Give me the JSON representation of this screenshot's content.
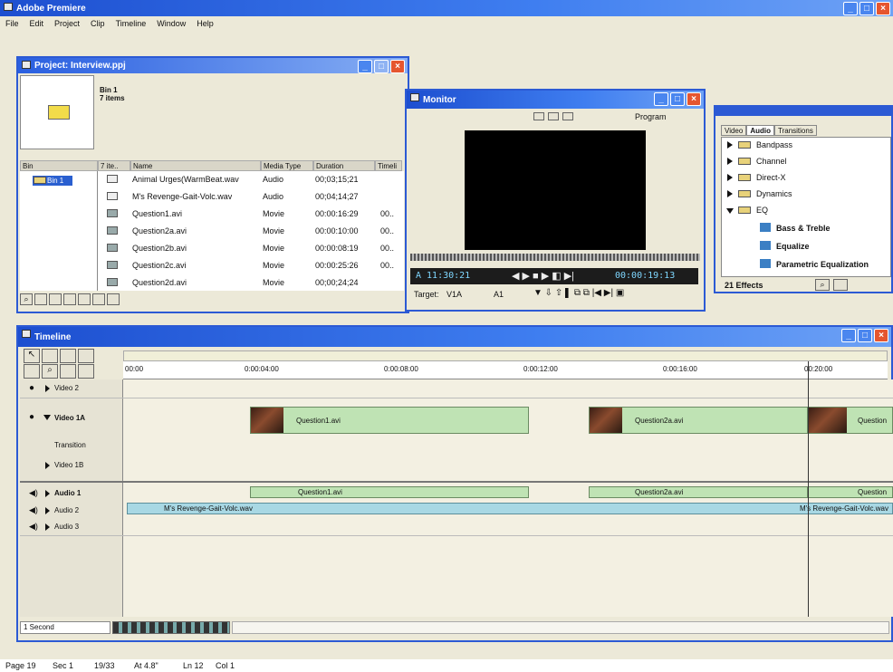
{
  "app": {
    "title": "Adobe Premiere"
  },
  "menu": [
    "File",
    "Edit",
    "Project",
    "Clip",
    "Timeline",
    "Window",
    "Help"
  ],
  "project": {
    "title": "Project: Interview.ppj",
    "bin_name": "Bin 1",
    "bin_count": "7 items",
    "columns": [
      "Bin",
      "7 ite..",
      "Name",
      "Media Type",
      "Duration",
      "Timeli"
    ],
    "sidebar_bin": "Bin 1",
    "items": [
      {
        "name": "Animal Urges(WarmBeat.wav",
        "type": "Audio",
        "duration": "00;03;15;21",
        "extra": ""
      },
      {
        "name": "M's Revenge-Gait-Volc.wav",
        "type": "Audio",
        "duration": "00;04;14;27",
        "extra": ""
      },
      {
        "name": "Question1.avi",
        "type": "Movie",
        "duration": "00:00:16:29",
        "extra": "00.."
      },
      {
        "name": "Question2a.avi",
        "type": "Movie",
        "duration": "00:00:10:00",
        "extra": "00.."
      },
      {
        "name": "Question2b.avi",
        "type": "Movie",
        "duration": "00:00:08:19",
        "extra": "00.."
      },
      {
        "name": "Question2c.avi",
        "type": "Movie",
        "duration": "00:00:25:26",
        "extra": "00.."
      },
      {
        "name": "Question2d.avi",
        "type": "Movie",
        "duration": "00;00;24;24",
        "extra": ""
      }
    ]
  },
  "monitor": {
    "title": "Monitor",
    "mode": "Program",
    "timecode_left": "A 11:30:21",
    "timecode_right": "00:00:19:13",
    "target_label": "Target:",
    "target_video": "V1A",
    "target_audio": "A1"
  },
  "effects": {
    "tabs": [
      "Video",
      "Audio",
      "Transitions"
    ],
    "active_tab": "Audio",
    "folders": [
      "Bandpass",
      "Channel",
      "Direct-X",
      "Dynamics",
      "EQ"
    ],
    "eq_items": [
      "Bass & Treble",
      "Equalize",
      "Parametric Equalization"
    ],
    "count": "21 Effects"
  },
  "timeline": {
    "title": "Timeline",
    "ruler": [
      "00:00",
      "0:00:04:00",
      "0:00:08:00",
      "0:00:12:00",
      "0:00:16:00",
      "00:20:00"
    ],
    "tracks": [
      "Video 2",
      "Video 1A",
      "Transition",
      "Video 1B",
      "Audio 1",
      "Audio 2",
      "Audio 3"
    ],
    "video_clips": [
      "Question1.avi",
      "Question2a.avi",
      "Question"
    ],
    "audio1_clips": [
      "Question1.avi",
      "Question2a.avi",
      "Question"
    ],
    "audio2_clip": "M's Revenge-Gait-Volc.wav",
    "audio2_clip_end": "M's Revenge-Gait-Volc.wav",
    "scale": "1 Second"
  },
  "statusbar": {
    "page": "Page 19",
    "sec": "Sec 1",
    "pages": "19/33",
    "at": "At 4.8\"",
    "ln": "Ln 12",
    "col": "Col 1"
  }
}
